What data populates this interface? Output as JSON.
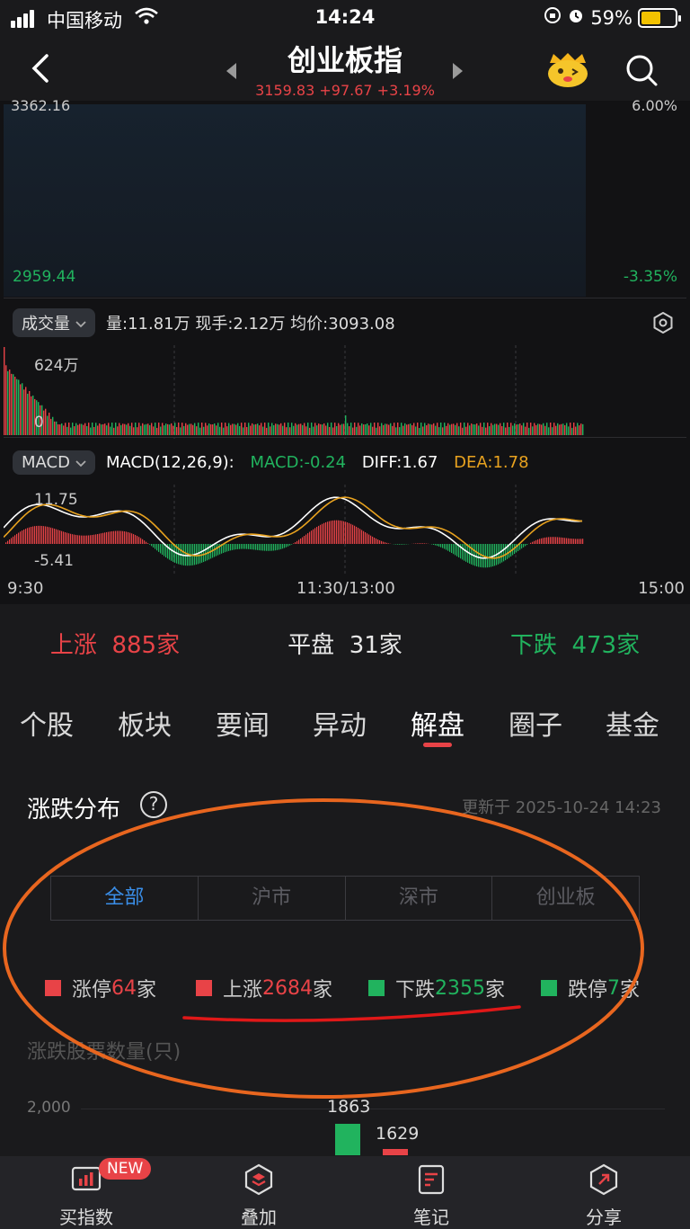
{
  "status_bar": {
    "carrier": "中国移动",
    "time": "14:24",
    "battery": "59%"
  },
  "header": {
    "title": "创业板指",
    "quote": "3159.83 +97.67 +3.19%"
  },
  "price_chart": {
    "top_left_value": "3362.16",
    "top_right_value": "6.00%",
    "bottom_left_value": "2959.44",
    "bottom_right_value": "-3.35%"
  },
  "volume_panel": {
    "selector": "成交量",
    "info": "量:11.81万  现手:2.12万  均价:3093.08",
    "max_label": "624万",
    "zero_label": "0"
  },
  "macd_panel": {
    "selector": "MACD",
    "params": "MACD(12,26,9):",
    "macd": "MACD:-0.24",
    "diff": "DIFF:1.67",
    "dea": "DEA:1.78",
    "high_label": "11.75",
    "low_label": "-5.41"
  },
  "time_axis": {
    "start": "9:30",
    "mid": "11:30/13:00",
    "end": "15:00"
  },
  "stats": {
    "up_label": "上涨",
    "up_value": "885家",
    "flat_label": "平盘",
    "flat_value": "31家",
    "down_label": "下跌",
    "down_value": "473家"
  },
  "tabs": [
    "个股",
    "板块",
    "要闻",
    "异动",
    "解盘",
    "圈子",
    "基金"
  ],
  "active_tab": "解盘",
  "distribution": {
    "title": "涨跌分布",
    "help": "?",
    "updated": "更新于 2025-10-24 14:23",
    "segments": [
      "全部",
      "沪市",
      "深市",
      "创业板"
    ],
    "active_segment": "全部",
    "legend": [
      {
        "pre": "涨停",
        "num": "64",
        "post": "家",
        "color": "#e84347"
      },
      {
        "pre": "上涨",
        "num": "2684",
        "post": "家",
        "color": "#e84347"
      },
      {
        "pre": "下跌",
        "num": "2355",
        "post": "家",
        "color": "#21b35e"
      },
      {
        "pre": "跌停",
        "num": "7",
        "post": "家",
        "color": "#21b35e"
      }
    ],
    "chart_label": "涨跌股票数量(只)",
    "y_tick": "2,000",
    "bar_label_1": "1863",
    "bar_label_2": "1629"
  },
  "bottom_nav": [
    {
      "label": "买指数",
      "badge": "NEW"
    },
    {
      "label": "叠加"
    },
    {
      "label": "笔记"
    },
    {
      "label": "分享"
    }
  ],
  "colors": {
    "up": "#e84347",
    "down": "#21b35e",
    "accent": "#3a8ee8",
    "annotation": "#e8661f"
  }
}
